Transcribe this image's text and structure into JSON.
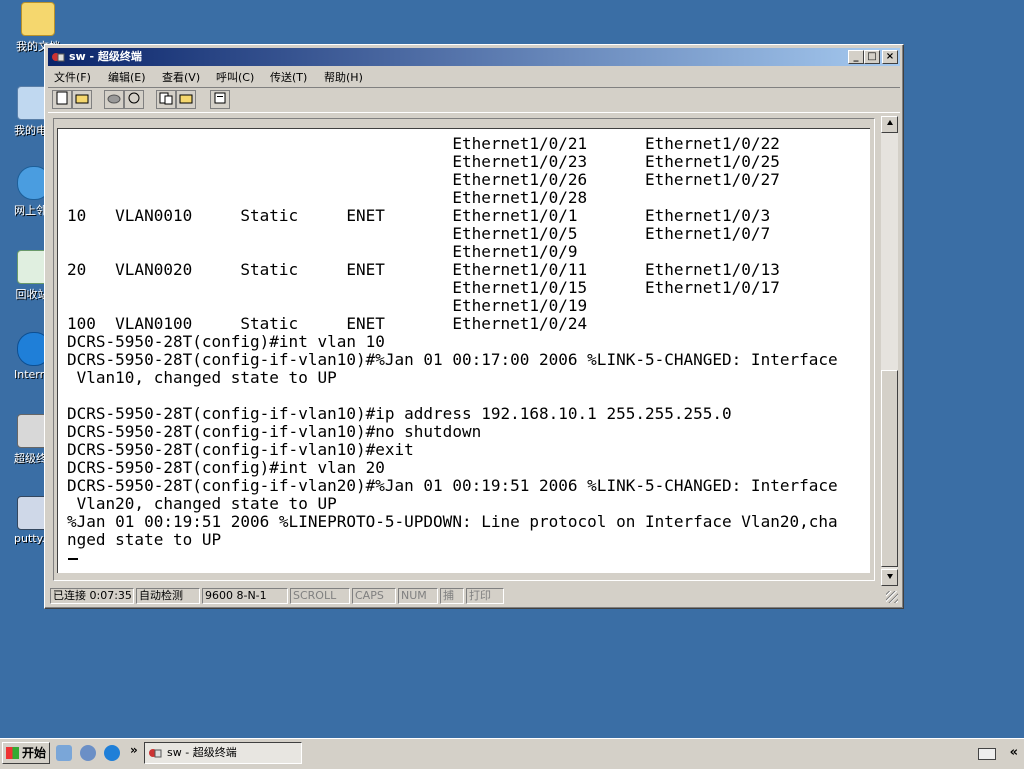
{
  "desktop": {
    "icons": [
      {
        "label": "我的文档",
        "name": "my-documents-icon"
      },
      {
        "label": "我的电脑",
        "name": "my-computer-icon"
      },
      {
        "label": "网上邻居",
        "name": "network-places-icon"
      },
      {
        "label": "回收站",
        "name": "recycle-bin-icon"
      },
      {
        "label": "Internet Explorer",
        "name": "internet-explorer-icon"
      },
      {
        "label": "超级终端",
        "name": "hyperterminal-shortcut-icon"
      },
      {
        "label": "putty.exe",
        "name": "putty-icon"
      }
    ]
  },
  "window": {
    "title": "sw - 超级终端",
    "controls": {
      "minimize": "_",
      "maximize": "□",
      "close": "×"
    },
    "menu": [
      "文件(F)",
      "编辑(E)",
      "查看(V)",
      "呼叫(C)",
      "传送(T)",
      "帮助(H)"
    ],
    "toolbar": [
      "new-icon",
      "open-icon",
      "disconnect-icon",
      "phone-icon",
      "send-icon",
      "receive-icon",
      "properties-icon"
    ]
  },
  "terminal": {
    "text": "                                        Ethernet1/0/21      Ethernet1/0/22\n                                        Ethernet1/0/23      Ethernet1/0/25\n                                        Ethernet1/0/26      Ethernet1/0/27\n                                        Ethernet1/0/28\n10   VLAN0010     Static     ENET       Ethernet1/0/1       Ethernet1/0/3\n                                        Ethernet1/0/5       Ethernet1/0/7\n                                        Ethernet1/0/9\n20   VLAN0020     Static     ENET       Ethernet1/0/11      Ethernet1/0/13\n                                        Ethernet1/0/15      Ethernet1/0/17\n                                        Ethernet1/0/19\n100  VLAN0100     Static     ENET       Ethernet1/0/24\nDCRS-5950-28T(config)#int vlan 10\nDCRS-5950-28T(config-if-vlan10)#%Jan 01 00:17:00 2006 %LINK-5-CHANGED: Interface\n Vlan10, changed state to UP\n\nDCRS-5950-28T(config-if-vlan10)#ip address 192.168.10.1 255.255.255.0\nDCRS-5950-28T(config-if-vlan10)#no shutdown\nDCRS-5950-28T(config-if-vlan10)#exit\nDCRS-5950-28T(config)#int vlan 20\nDCRS-5950-28T(config-if-vlan20)#%Jan 01 00:19:51 2006 %LINK-5-CHANGED: Interface\n Vlan20, changed state to UP\n%Jan 01 00:19:51 2006 %LINEPROTO-5-UPDOWN: Line protocol on Interface Vlan20,cha\nnged state to UP"
  },
  "statusbar": {
    "connected": "已连接 0:07:35",
    "detect": "自动检测",
    "settings": "9600 8-N-1",
    "scroll": "SCROLL",
    "caps": "CAPS",
    "num": "NUM",
    "capture": "捕",
    "print": "打印"
  },
  "taskbar": {
    "start": "开始",
    "chevron": "»",
    "task_title": "sw - 超级终端",
    "tray_chevron": "«"
  }
}
